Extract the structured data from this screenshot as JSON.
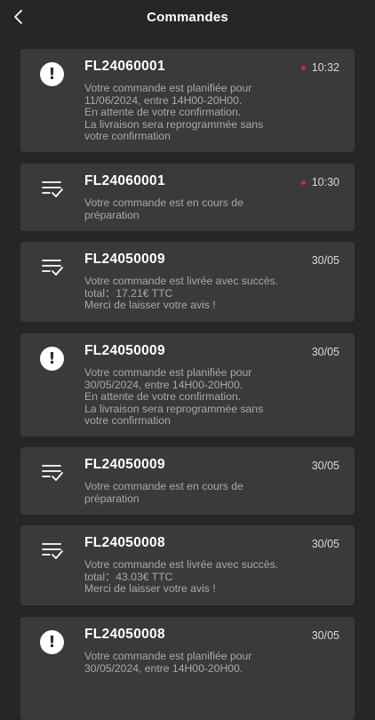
{
  "header": {
    "title": "Commandes",
    "back_icon": "chevron-left-icon"
  },
  "orders": [
    {
      "code": "FL24060001",
      "time": "10:32",
      "unread": true,
      "icon": "alert-icon",
      "lines": [
        "Votre commande est planifiée pour",
        "11/06/2024, entre 14H00-20H00.",
        "En attente de votre confirmation.",
        "La livraison sera reprogrammée sans",
        "votre confirmation"
      ]
    },
    {
      "code": "FL24060001",
      "time": "10:30",
      "unread": true,
      "icon": "checklist-icon",
      "lines": [
        "Votre commande est en cours de",
        "préparation"
      ]
    },
    {
      "code": "FL24050009",
      "time": "30/05",
      "unread": false,
      "icon": "checklist-icon",
      "lines": [
        "Votre commande est livrée avec succès.",
        "total：17.21€ TTC",
        "Merci de laisser votre avis !"
      ]
    },
    {
      "code": "FL24050009",
      "time": "30/05",
      "unread": false,
      "icon": "alert-icon",
      "lines": [
        "Votre commande est planifiée pour",
        "30/05/2024, entre 14H00-20H00.",
        "En attente de votre confirmation.",
        "La livraison sera reprogrammée sans",
        "votre confirmation"
      ]
    },
    {
      "code": "FL24050009",
      "time": "30/05",
      "unread": false,
      "icon": "checklist-icon",
      "lines": [
        "Votre commande est en cours de",
        "préparation"
      ]
    },
    {
      "code": "FL24050008",
      "time": "30/05",
      "unread": false,
      "icon": "checklist-icon",
      "lines": [
        "Votre commande est livrée avec succès.",
        "total：43.03€ TTC",
        "Merci de laisser votre avis !"
      ]
    },
    {
      "code": "FL24050008",
      "time": "30/05",
      "unread": false,
      "icon": "alert-icon",
      "lines": [
        "Votre commande est planifiée pour",
        "30/05/2024, entre 14H00-20H00."
      ]
    }
  ],
  "colors": {
    "background": "#262626",
    "card": "#3a3a3a",
    "unread_dot": "#d12a3c",
    "text_muted": "#a9a9a9"
  }
}
